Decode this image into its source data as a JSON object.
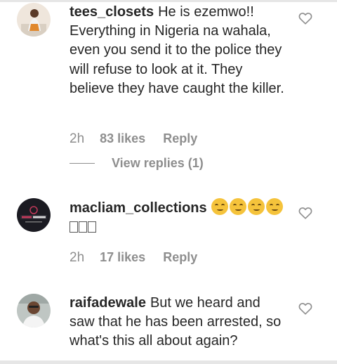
{
  "comments": [
    {
      "username": "tees_closets",
      "text": "He is ezemwo!! Everything in Nigeria na wahala, even you send it to the police they will refuse to look at it. They believe they have caught the killer.",
      "time": "2h",
      "likes": "83 likes",
      "reply": "Reply",
      "view_replies": "View replies (1)"
    },
    {
      "username": "macliam_collections",
      "emoji": "smiling-face-emoji",
      "time": "2h",
      "likes": "17 likes",
      "reply": "Reply"
    },
    {
      "username": "raifadewale",
      "text": "But we heard and saw that he has been arrested, so what's this all about again?"
    }
  ],
  "icons": {
    "like": "heart-outline-icon"
  },
  "colors": {
    "text": "#262626",
    "muted": "#8e8e8e",
    "divider": "#e6e6e6"
  }
}
